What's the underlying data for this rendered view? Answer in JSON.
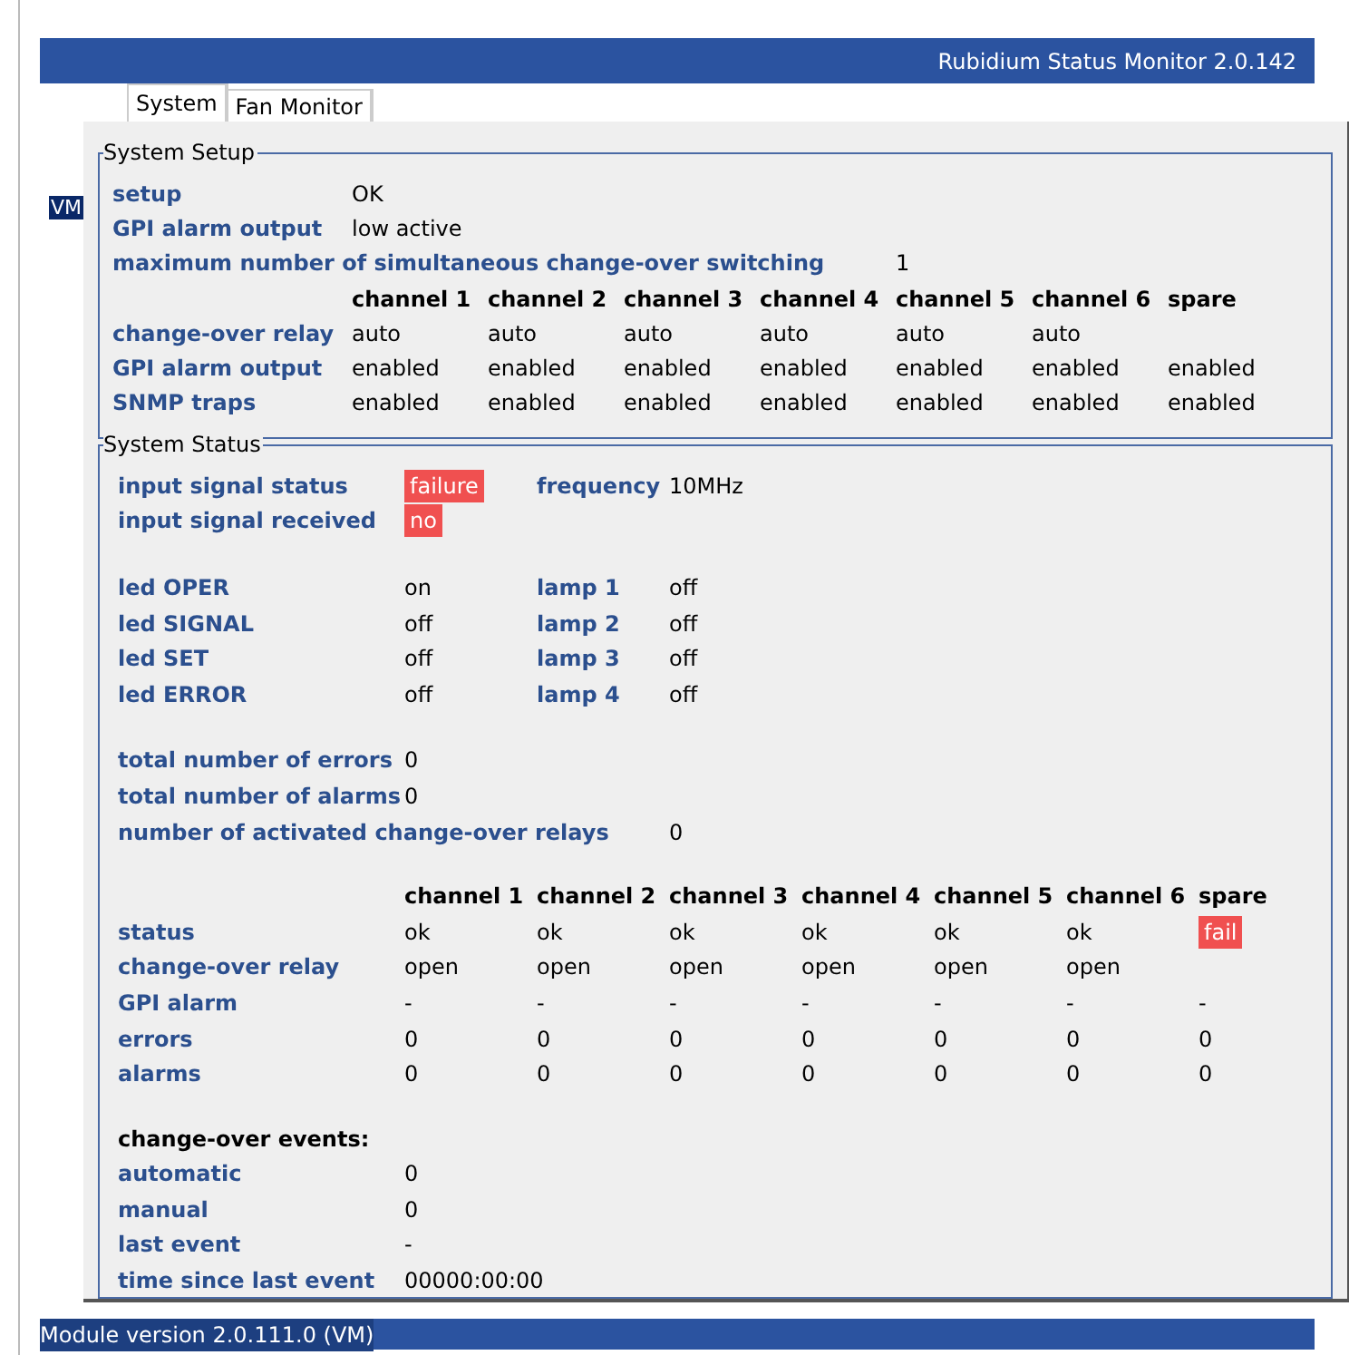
{
  "header": {
    "title": "Rubidium Status Monitor 2.0.142"
  },
  "badge": "VM",
  "tabs": [
    {
      "label": "System",
      "selected": true
    },
    {
      "label": "Fan Monitor",
      "selected": false
    }
  ],
  "system_setup": {
    "title": "System Setup",
    "rows": [
      {
        "kind": "normal",
        "label": "setup",
        "value": "OK"
      },
      {
        "kind": "normal",
        "label": "GPI alarm output",
        "value": "low active"
      },
      {
        "kind": "wide",
        "label": "maximum number of simultaneous change-over switching",
        "value": "1"
      }
    ],
    "table": {
      "columns": [
        "channel 1",
        "channel 2",
        "channel 3",
        "channel 4",
        "channel 5",
        "channel 6",
        "spare"
      ],
      "rows": [
        {
          "label": "change-over relay",
          "cells": [
            "auto",
            "auto",
            "auto",
            "auto",
            "auto",
            "auto"
          ]
        },
        {
          "label": "GPI alarm output",
          "cells": [
            "enabled",
            "enabled",
            "enabled",
            "enabled",
            "enabled",
            "enabled",
            "enabled"
          ]
        },
        {
          "label": "SNMP traps",
          "cells": [
            "enabled",
            "enabled",
            "enabled",
            "enabled",
            "enabled",
            "enabled",
            "enabled"
          ]
        }
      ]
    }
  },
  "system_status": {
    "title": "System Status",
    "signal": [
      {
        "label": "input signal status",
        "value": "failure",
        "alert": true,
        "label2": "frequency",
        "value2": "10MHz"
      },
      {
        "label": "input signal received",
        "value": "no",
        "alert": true
      }
    ],
    "leds": [
      {
        "label": "led OPER",
        "value": "on",
        "lamp_label": "lamp 1",
        "lamp_value": "off"
      },
      {
        "label": "led SIGNAL",
        "value": "off",
        "lamp_label": "lamp 2",
        "lamp_value": "off"
      },
      {
        "label": "led SET",
        "value": "off",
        "lamp_label": "lamp 3",
        "lamp_value": "off"
      },
      {
        "label": "led ERROR",
        "value": "off",
        "lamp_label": "lamp 4",
        "lamp_value": "off"
      }
    ],
    "counts": [
      {
        "kind": "normal",
        "label": "total number of errors",
        "value": "0"
      },
      {
        "kind": "normal",
        "label": "total number of alarms",
        "value": "0"
      },
      {
        "kind": "wide",
        "label": "number of activated change-over relays",
        "value": "0"
      }
    ],
    "table": {
      "columns": [
        "channel 1",
        "channel 2",
        "channel 3",
        "channel 4",
        "channel 5",
        "channel 6",
        "spare"
      ],
      "rows": [
        {
          "label": "status",
          "cells": [
            {
              "text": "ok",
              "alert": false
            },
            {
              "text": "ok",
              "alert": false
            },
            {
              "text": "ok",
              "alert": false
            },
            {
              "text": "ok",
              "alert": false
            },
            {
              "text": "ok",
              "alert": false
            },
            {
              "text": "ok",
              "alert": false
            },
            {
              "text": "fail",
              "alert": true
            }
          ]
        },
        {
          "label": "change-over relay",
          "cells": [
            {
              "text": "open",
              "alert": false
            },
            {
              "text": "open",
              "alert": false
            },
            {
              "text": "open",
              "alert": false
            },
            {
              "text": "open",
              "alert": false
            },
            {
              "text": "open",
              "alert": false
            },
            {
              "text": "open",
              "alert": false
            }
          ]
        },
        {
          "label": "GPI alarm",
          "cells": [
            {
              "text": "-",
              "alert": false
            },
            {
              "text": "-",
              "alert": false
            },
            {
              "text": "-",
              "alert": false
            },
            {
              "text": "-",
              "alert": false
            },
            {
              "text": "-",
              "alert": false
            },
            {
              "text": "-",
              "alert": false
            },
            {
              "text": "-",
              "alert": false
            }
          ]
        },
        {
          "label": "errors",
          "cells": [
            {
              "text": "0",
              "alert": false
            },
            {
              "text": "0",
              "alert": false
            },
            {
              "text": "0",
              "alert": false
            },
            {
              "text": "0",
              "alert": false
            },
            {
              "text": "0",
              "alert": false
            },
            {
              "text": "0",
              "alert": false
            },
            {
              "text": "0",
              "alert": false
            }
          ]
        },
        {
          "label": "alarms",
          "cells": [
            {
              "text": "0",
              "alert": false
            },
            {
              "text": "0",
              "alert": false
            },
            {
              "text": "0",
              "alert": false
            },
            {
              "text": "0",
              "alert": false
            },
            {
              "text": "0",
              "alert": false
            },
            {
              "text": "0",
              "alert": false
            },
            {
              "text": "0",
              "alert": false
            }
          ]
        }
      ]
    },
    "events": {
      "title": "change-over events:",
      "rows": [
        {
          "label": "automatic",
          "value": "0"
        },
        {
          "label": "manual",
          "value": "0"
        },
        {
          "label": "last event",
          "value": "-"
        },
        {
          "label": "time since last event",
          "value": "00000:00:00"
        }
      ]
    }
  },
  "status_bar": "Module version 2.0.111.0 (VM)"
}
